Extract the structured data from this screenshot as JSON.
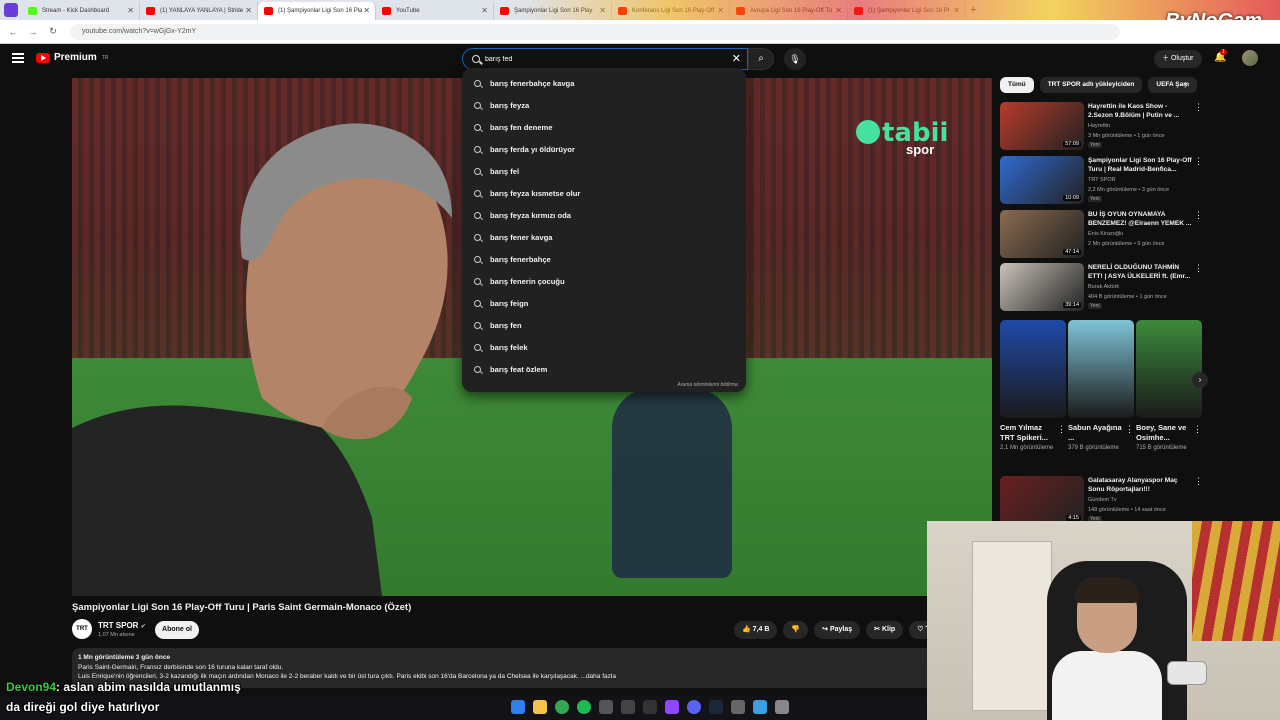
{
  "browser": {
    "tabs": [
      {
        "label": "Stream - Kick Dashboard",
        "type": "kick",
        "active": false
      },
      {
        "label": "(1) YANLAYA YANLAYA | Stride",
        "type": "youtube",
        "active": false
      },
      {
        "label": "(1) Şampiyonlar Ligi Son 16 Pla",
        "type": "youtube",
        "active": true
      },
      {
        "label": "YouTube",
        "type": "youtube",
        "active": false
      },
      {
        "label": "Şampiyonlar Ligi Son 16 Play",
        "type": "youtube",
        "active": false
      },
      {
        "label": "Konferans Ligi Son 16 Play-Off",
        "type": "youtube",
        "active": false
      },
      {
        "label": "Avrupa Ligi Son 16 Play-Off Tu",
        "type": "youtube",
        "active": false
      },
      {
        "label": "(1) Şampiyonlar Ligi Son 16 Pl",
        "type": "youtube",
        "active": false
      }
    ],
    "new_tab": "+",
    "url": "youtube.com/watch?v=wGjGx-Y2mY",
    "overlay_brand": "ByNoGam"
  },
  "header": {
    "logo_text": "Premium",
    "logo_sup": "TR",
    "search_value": "barış fed",
    "create_label": "Oluştur",
    "notification_count": "1"
  },
  "suggestions": {
    "items": [
      "barış fenerbahçe kavga",
      "barış feyza",
      "barış fen deneme",
      "barış ferda yı öldürüyor",
      "barış fel",
      "barış feyza kısmetse olur",
      "barış feyza kırmızı oda",
      "barış fener kavga",
      "barış fenerbahçe",
      "barış fenerin çocuğu",
      "barış feign",
      "barış fen",
      "barış felek",
      "barış feat özlem"
    ],
    "report_label": "Arama tahminlerini bildirme"
  },
  "video": {
    "overlay_brand": "tabii",
    "overlay_sub": "spor",
    "title": "Şampiyonlar Ligi Son 16 Play-Off Turu | Paris Saint Germain-Monaco (Özet)",
    "channel": "TRT SPOR",
    "channel_avatar": "TRT",
    "subscribers": "1,07 Mn abone",
    "subscribe_label": "Abone ol",
    "likes": "7,4 B",
    "share_label": "Paylaş",
    "clip_label": "Klip",
    "thanks_label": "T"
  },
  "description": {
    "meta": "1 Mn görüntüleme  3 gün önce",
    "line1": "Paris Saint-Germain, Fransız derbisinde son 16 turuna kalan taraf oldu.",
    "line2": "Luis Enrique'nin öğrencileri, 3-2 kazandığı ilk maçın ardından Monaco ile 2-2 beraber kaldı ve bir üst tura çıktı. Paris ekibi son 16'da Barcelona ya da Chelsea ile karşılaşacak.  ...daha fazla"
  },
  "sidebar": {
    "chips": [
      "Tümü",
      "TRT SPOR adlı yükleyiciden",
      "UEFA Şam"
    ],
    "recommendations": [
      {
        "title": "Hayrettin ile Kaos Show - 2.Sezon 9.Bölüm | Putin ve ...",
        "channel": "Hayrettin",
        "meta": "3 Mn görüntüleme  •  1 gün önce",
        "badge": "Yeni",
        "duration": "57:09",
        "color": "#b83a2a"
      },
      {
        "title": "Şampiyonlar Ligi Son 16 Play-Off Turu | Real Madrid-Benfica...",
        "channel": "TRT SPOR",
        "meta": "2,2 Mn görüntüleme  •  3 gün önce",
        "badge": "Yeni",
        "duration": "10:09",
        "color": "#2f6ad1"
      },
      {
        "title": "BU İŞ OYUN OYNAMAYA BENZEMEZ! @Elraenn YEMEK ...",
        "channel": "Enis Kirazoğlu",
        "meta": "2 Mn görüntüleme  •  9 gün önce",
        "badge": "",
        "duration": "47:14",
        "color": "#8a6b4f"
      },
      {
        "title": "NERELİ OLDUĞUNU TAHMİN ETT! | ASYA ÜLKELERİ ft. (Emr...",
        "channel": "Burak Aktürk",
        "meta": "404 B görüntüleme  •  1 gün önce",
        "badge": "Yeni",
        "duration": "39:14",
        "color": "#c9c2b8"
      }
    ],
    "shorts": [
      {
        "title": "Cem Yılmaz TRT Spikeri...",
        "views": "2,1 Mn görüntüleme",
        "color": "#1f4aa8"
      },
      {
        "title": "Sabun Ayağına ...",
        "views": "379 B görüntüleme",
        "color": "#7fc4d8"
      },
      {
        "title": "Boey, Sane ve Osimhe...",
        "views": "715 B görüntüleme",
        "color": "#3b8a3b"
      }
    ],
    "last_rec": {
      "title": "Galatasaray Alanyaspor Maç Sonu Röportajları!!!",
      "channel": "Gündem Tv",
      "meta": "148 görüntüleme  •  14 saat önce",
      "badge": "Yeni",
      "duration": "4:15",
      "color": "#6b1f1f"
    }
  },
  "chat": {
    "user": "Devon94",
    "message": ": aslan abim nasılda umutlanmış",
    "message2": "da direği gol diye hatırlıyor"
  }
}
